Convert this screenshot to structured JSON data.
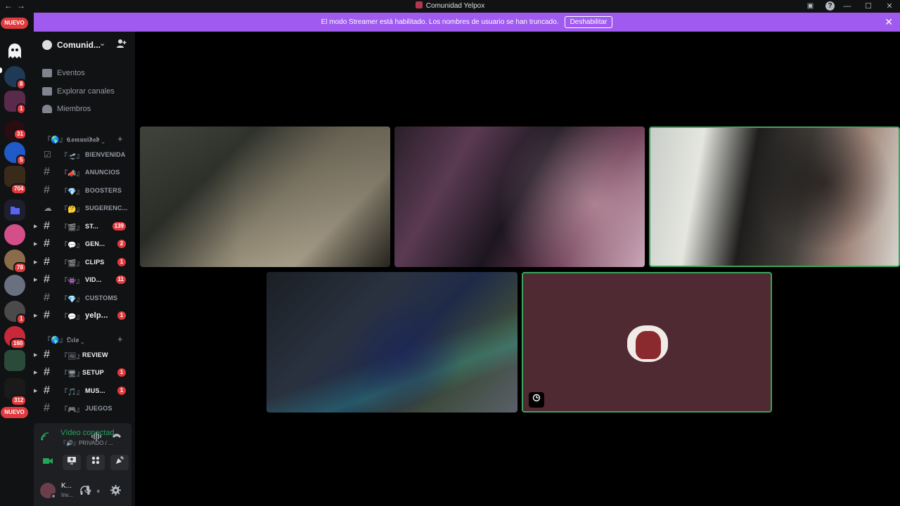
{
  "window": {
    "title": "Comunidad Yelpox",
    "nav_back": "←",
    "nav_fwd": "→",
    "minimize": "—",
    "maximize": "☐",
    "close": "✕",
    "inbox_icon": "▣",
    "help_icon": "?"
  },
  "banner": {
    "text": "El modo Streamer está habilitado. Los nombres de usuario se han truncado.",
    "button": "Deshabilitar",
    "close": "✕"
  },
  "guilds": {
    "new_label_top": "NUEVO",
    "new_label_bottom": "NUEVO",
    "badges": [
      "8",
      "1",
      "31",
      "5",
      "704",
      "78",
      "1",
      "160",
      "312"
    ]
  },
  "server": {
    "name": "Comunid...",
    "chevron": "⌄",
    "nav": [
      {
        "label": "Eventos"
      },
      {
        "label": "Explorar canales"
      },
      {
        "label": "Miembros"
      }
    ],
    "categories": [
      {
        "label": "『🌎』𝕮𝖔𝖒𝖚𝖓𝖎𝖉𝖆𝖉 ⌄",
        "plus": "+"
      },
      {
        "label": "『🌎』𝕺𝖈𝖎𝖔 ⌄",
        "plus": "+"
      }
    ],
    "channels": [
      {
        "emoji": "『🛫』",
        "name": "BIENVENIDA",
        "badge": ""
      },
      {
        "emoji": "『📣』",
        "name": "ANUNCIOS",
        "badge": ""
      },
      {
        "emoji": "『💎』",
        "name": "BOOSTERS",
        "badge": ""
      },
      {
        "emoji": "『🤔』",
        "name": "SUGERENC...",
        "badge": ""
      },
      {
        "emoji": "『🎬』",
        "name": "ST...",
        "badge": "139"
      },
      {
        "emoji": "『💬』",
        "name": "GEN...",
        "badge": "2"
      },
      {
        "emoji": "『🎬』",
        "name": "CLIPS",
        "badge": "1"
      },
      {
        "emoji": "『👾』",
        "name": "VID...",
        "badge": "11"
      },
      {
        "emoji": "『💎』",
        "name": "CUSTOMS",
        "badge": ""
      },
      {
        "emoji": "『💬』",
        "name": "yelp...",
        "badge": "1"
      },
      {
        "emoji": "『🖼』",
        "name": "REVIEW",
        "badge": ""
      },
      {
        "emoji": "『🖥』",
        "name": "SETUP",
        "badge": "1"
      },
      {
        "emoji": "『🎵』",
        "name": "MUS...",
        "badge": "1"
      },
      {
        "emoji": "『🎮』",
        "name": "JUEGOS",
        "badge": ""
      }
    ]
  },
  "voice": {
    "status": "Vídeo conectad",
    "channel": "『🔊』PRIVADO / ..."
  },
  "user": {
    "name": "K...",
    "status": "Inv..."
  }
}
